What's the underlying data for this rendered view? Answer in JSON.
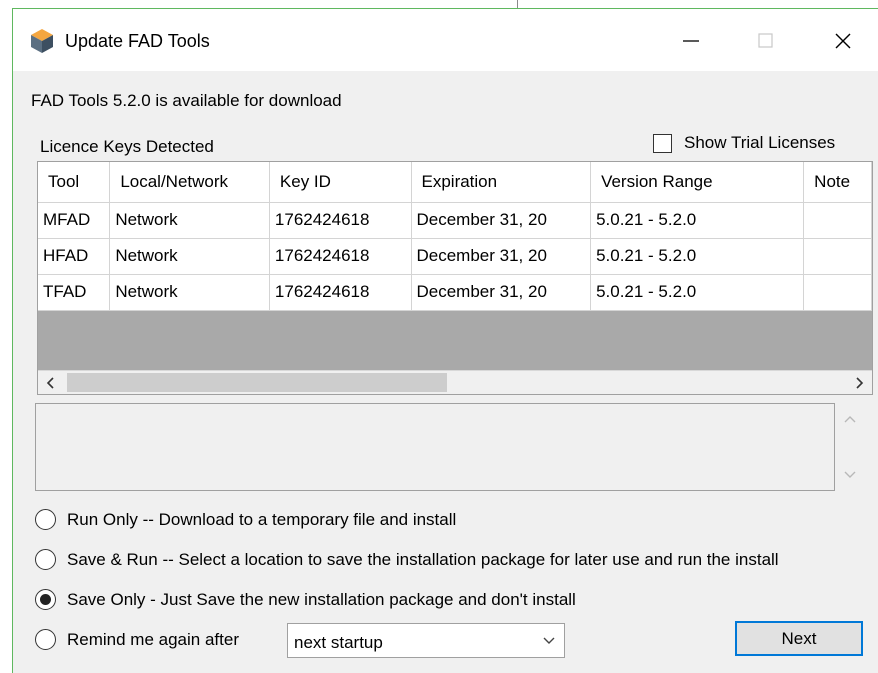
{
  "window": {
    "title": "Update FAD Tools",
    "controls": {
      "minimize": "minimize",
      "maximize": "maximize",
      "close": "close"
    }
  },
  "info_text": "FAD Tools 5.2.0 is available for download",
  "keys_label": "Licence Keys Detected",
  "show_trial": {
    "label": "Show Trial Licenses",
    "checked": false
  },
  "table": {
    "columns": [
      "Tool",
      "Local/Network",
      "Key ID",
      "Expiration",
      "Version Range",
      "Note"
    ],
    "rows": [
      [
        "MFAD",
        "Network",
        "1762424618",
        "December 31, 20",
        "5.0.21 - 5.2.0",
        ""
      ],
      [
        "HFAD",
        "Network",
        "1762424618",
        "December 31, 20",
        "5.0.21 - 5.2.0",
        ""
      ],
      [
        "TFAD",
        "Network",
        "1762424618",
        "December 31, 20",
        "5.0.21 - 5.2.0",
        ""
      ]
    ]
  },
  "options": [
    {
      "label": "Run Only -- Download to a temporary file and install",
      "checked": false
    },
    {
      "label": "Save & Run -- Select a location to save the installation package for later use and run the install",
      "checked": false
    },
    {
      "label": "Save Only - Just Save the new installation package and don't install",
      "checked": true
    },
    {
      "label": "Remind me again after",
      "checked": false
    }
  ],
  "remind_select": {
    "value": "next startup"
  },
  "next_button": "Next",
  "colors": {
    "accent": "#0078d7",
    "window_border": "#5fb85f"
  }
}
